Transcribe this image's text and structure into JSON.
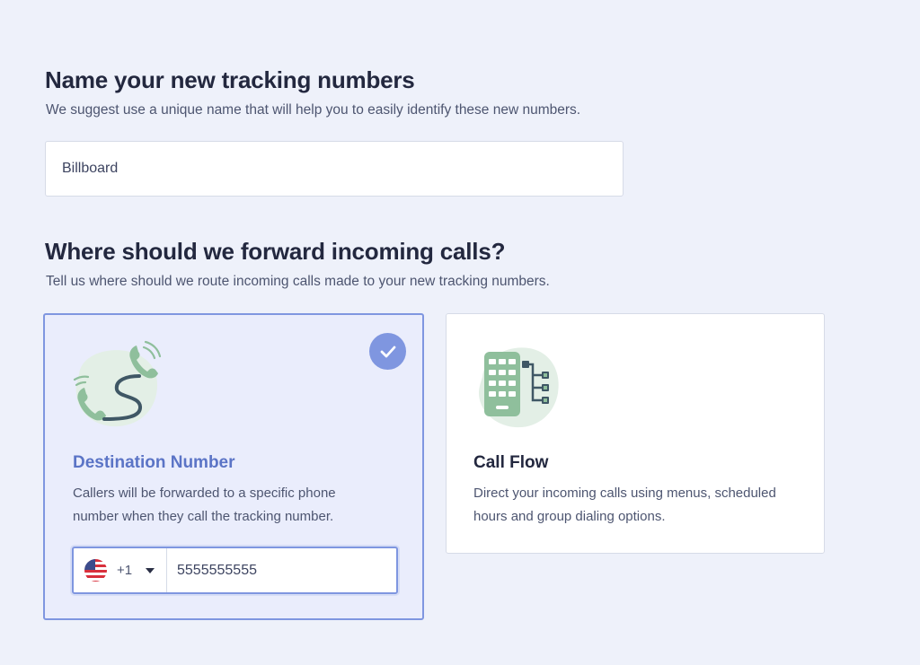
{
  "section_name": {
    "title": "Name your new tracking numbers",
    "subtitle": "We suggest use a unique name that will help you to easily identify these new numbers.",
    "input_value": "Billboard"
  },
  "section_forward": {
    "title": "Where should we forward incoming calls?",
    "subtitle": "Tell us where should we route incoming calls made to your new tracking numbers."
  },
  "options": {
    "destination": {
      "title": "Destination Number",
      "description": "Callers will be forwarded to a specific phone number when they call the tracking number.",
      "selected": true,
      "icon": "phone-forward-icon",
      "country_code": "+1",
      "country_flag": "us-flag-icon",
      "phone_value": "5555555555"
    },
    "call_flow": {
      "title": "Call Flow",
      "description": "Direct your incoming calls using menus, scheduled hours and group dialing options.",
      "selected": false,
      "icon": "keypad-flow-icon"
    }
  },
  "colors": {
    "background": "#eef1fa",
    "accent": "#7f96e0",
    "accent_text": "#5b74c6",
    "illustration_green": "#8fbf9c",
    "illustration_dark": "#3f5765"
  }
}
